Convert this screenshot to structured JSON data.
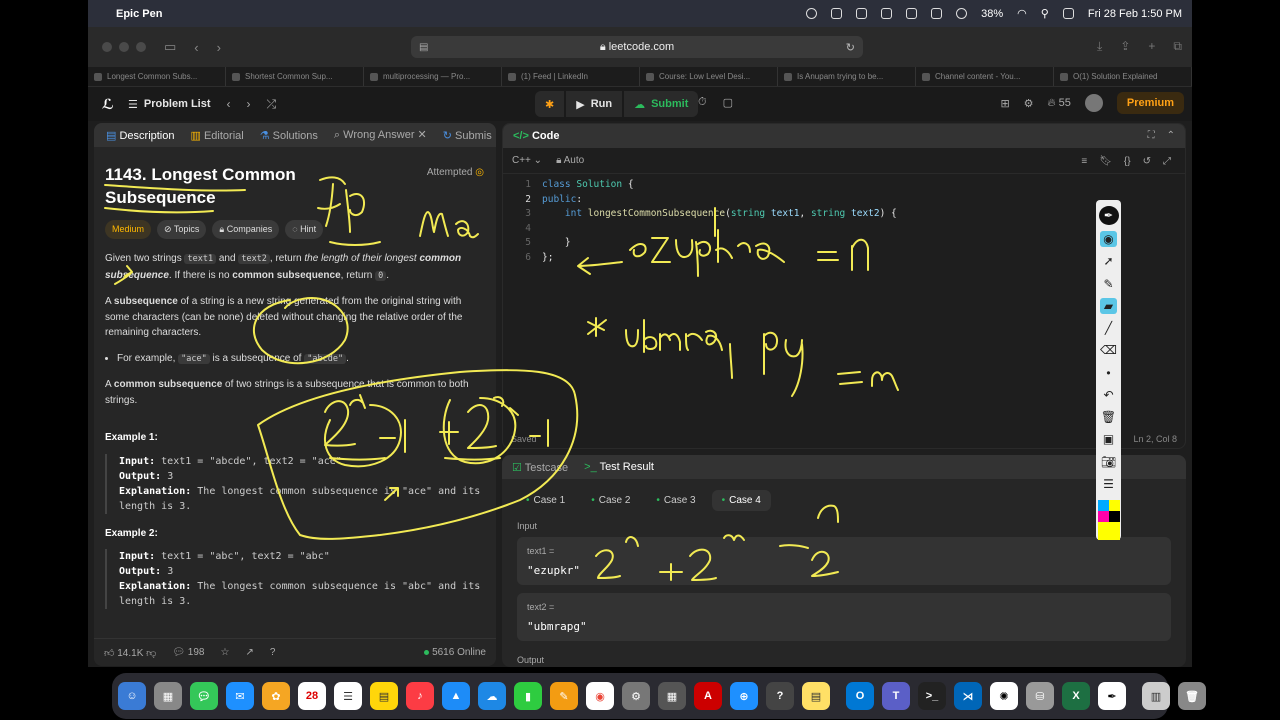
{
  "menubar": {
    "app_name": "Epic Pen",
    "battery": "38%",
    "datetime": "Fri 28 Feb  1:50 PM"
  },
  "browser": {
    "url": "leetcode.com",
    "tabs": [
      "Longest Common Subs...",
      "Shortest Common Sup...",
      "multiprocessing — Pro...",
      "(1) Feed | LinkedIn",
      "Course: Low Level Desi...",
      "Is Anupam trying to be...",
      "Channel content - You...",
      "O(1) Solution Explained"
    ]
  },
  "header": {
    "problem_list": "Problem List",
    "run": "Run",
    "submit": "Submit",
    "streak": "55",
    "premium": "Premium"
  },
  "left": {
    "tabs": [
      "Description",
      "Editorial",
      "Solutions",
      "Wrong Answer",
      "Submis"
    ],
    "title": "1143. Longest Common Subsequence",
    "status": "Attempted",
    "difficulty": "Medium",
    "tags": [
      "Topics",
      "Companies",
      "Hint"
    ],
    "p1_a": "Given two strings ",
    "p1_c1": "text1",
    "p1_b": " and ",
    "p1_c2": "text2",
    "p1_c": ", return ",
    "p1_d": "the length of their longest ",
    "p1_e": "common subsequence",
    "p1_f": ". If there is no ",
    "p1_g": "common subsequence",
    "p1_h": ", return ",
    "p1_c3": "0",
    "p1_i": ".",
    "p2_a": "A ",
    "p2_b": "subsequence",
    "p2_c": " of a string is a new string generated from the original string with some characters (can be none) deleted without changing the relative order of the remaining characters.",
    "li_a": "For example, ",
    "li_c1": "\"ace\"",
    "li_b": " is a subsequence of ",
    "li_c2": "\"abcde\"",
    "li_c": ".",
    "p3_a": "A ",
    "p3_b": "common subsequence",
    "p3_c": " of two strings is a subsequence that is common to both strings.",
    "examples": [
      {
        "heading": "Example 1:",
        "input": "text1 = \"abcde\", text2 = \"ace\"",
        "output": "3",
        "explanation": "The longest common subsequence is \"ace\" and its length is 3."
      },
      {
        "heading": "Example 2:",
        "input": "text1 = \"abc\", text2 = \"abc\"",
        "output": "3",
        "explanation": "The longest common subsequence is \"abc\" and its length is 3."
      }
    ],
    "labels": {
      "input": "Input:",
      "output": "Output:",
      "explanation": "Explanation:"
    },
    "likes": "14.1K",
    "comments": "198",
    "online": "5616 Online"
  },
  "code": {
    "title": "Code",
    "language": "C++",
    "mode": "Auto",
    "saved": "Saved",
    "cursor": "Ln 2, Col 8"
  },
  "test": {
    "tab_testcase": "Testcase",
    "tab_result": "Test Result",
    "cases": [
      "Case 1",
      "Case 2",
      "Case 3",
      "Case 4"
    ],
    "input_label": "Input",
    "text1_name": "text1 =",
    "text1_value": "\"ezupkr\"",
    "text2_name": "text2 =",
    "text2_value": "\"ubmrapg\"",
    "output_label": "Output"
  },
  "colors": {
    "accent_green": "#2cbb5d",
    "premium_orange": "#ffa116",
    "medium_yellow": "#ffb800",
    "ink_yellow": "#f2ea54"
  }
}
